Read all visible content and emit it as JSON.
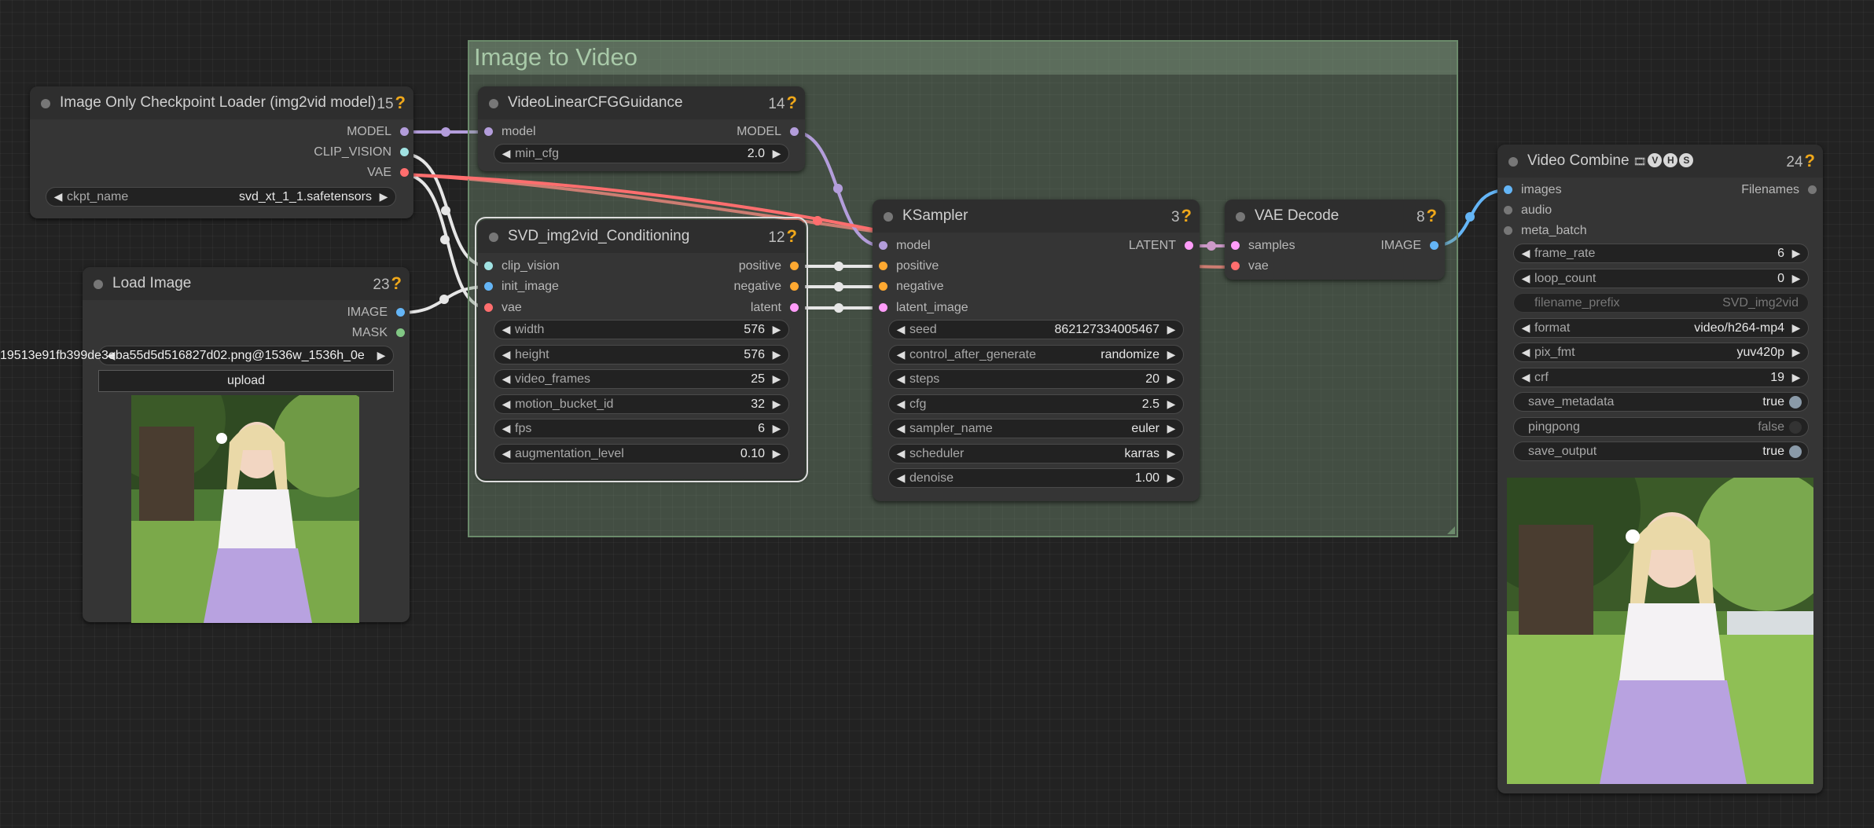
{
  "group": {
    "title": "Image to Video"
  },
  "colors": {
    "model": "#b39ddb",
    "clip_vision": "#a1e3e3",
    "vae": "#ff6e6e",
    "image": "#64b5f6",
    "mask": "#81c784",
    "conditioning": "#ffa931",
    "latent": "#ff9cf9",
    "link_white": "#e6e6e6",
    "group_bg": "#4e5e4e"
  },
  "nodes": {
    "checkpoint": {
      "title": "Image Only Checkpoint Loader (img2vid model)",
      "id": "15",
      "outputs": [
        "MODEL",
        "CLIP_VISION",
        "VAE"
      ],
      "widgets": [
        {
          "name": "ckpt_name",
          "value": "svd_xt_1_1.safetensors"
        }
      ]
    },
    "load_image": {
      "title": "Load Image",
      "id": "23",
      "outputs": [
        "IMAGE",
        "MASK"
      ],
      "image_widget_value": "19513e91fb399de3eba55d5d516827d02.png@1536w_1536h_0e",
      "upload_label": "upload",
      "preview_icon": "girl-under-tree-photo"
    },
    "cfg_guidance": {
      "title": "VideoLinearCFGGuidance",
      "id": "14",
      "inputs": [
        "model"
      ],
      "outputs": [
        "MODEL"
      ],
      "widgets": [
        {
          "name": "min_cfg",
          "value": "2.0"
        }
      ]
    },
    "svd_cond": {
      "title": "SVD_img2vid_Conditioning",
      "id": "12",
      "inputs": [
        "clip_vision",
        "init_image",
        "vae"
      ],
      "outputs": [
        "positive",
        "negative",
        "latent"
      ],
      "widgets": [
        {
          "name": "width",
          "value": "576"
        },
        {
          "name": "height",
          "value": "576"
        },
        {
          "name": "video_frames",
          "value": "25"
        },
        {
          "name": "motion_bucket_id",
          "value": "32"
        },
        {
          "name": "fps",
          "value": "6"
        },
        {
          "name": "augmentation_level",
          "value": "0.10"
        }
      ]
    },
    "ksampler": {
      "title": "KSampler",
      "id": "3",
      "inputs": [
        "model",
        "positive",
        "negative",
        "latent_image"
      ],
      "outputs": [
        "LATENT"
      ],
      "widgets": [
        {
          "name": "seed",
          "value": "862127334005467"
        },
        {
          "name": "control_after_generate",
          "value": "randomize"
        },
        {
          "name": "steps",
          "value": "20"
        },
        {
          "name": "cfg",
          "value": "2.5"
        },
        {
          "name": "sampler_name",
          "value": "euler"
        },
        {
          "name": "scheduler",
          "value": "karras"
        },
        {
          "name": "denoise",
          "value": "1.00"
        }
      ]
    },
    "vae_decode": {
      "title": "VAE Decode",
      "id": "8",
      "inputs": [
        "samples",
        "vae"
      ],
      "outputs": [
        "IMAGE"
      ]
    },
    "video_combine": {
      "title": "Video Combine",
      "badge": "VHS",
      "id": "24",
      "inputs": [
        "images",
        "audio",
        "meta_batch"
      ],
      "outputs": [
        "Filenames"
      ],
      "widgets": [
        {
          "name": "frame_rate",
          "value": "6"
        },
        {
          "name": "loop_count",
          "value": "0"
        },
        {
          "name": "filename_prefix",
          "value": "SVD_img2vid"
        },
        {
          "name": "format",
          "value": "video/h264-mp4"
        },
        {
          "name": "pix_fmt",
          "value": "yuv420p"
        },
        {
          "name": "crf",
          "value": "19"
        }
      ],
      "toggles": [
        {
          "name": "save_metadata",
          "value": "true"
        },
        {
          "name": "pingpong",
          "value": "false"
        },
        {
          "name": "save_output",
          "value": "true"
        }
      ],
      "preview_icon": "girl-under-tree-video-frame"
    }
  }
}
